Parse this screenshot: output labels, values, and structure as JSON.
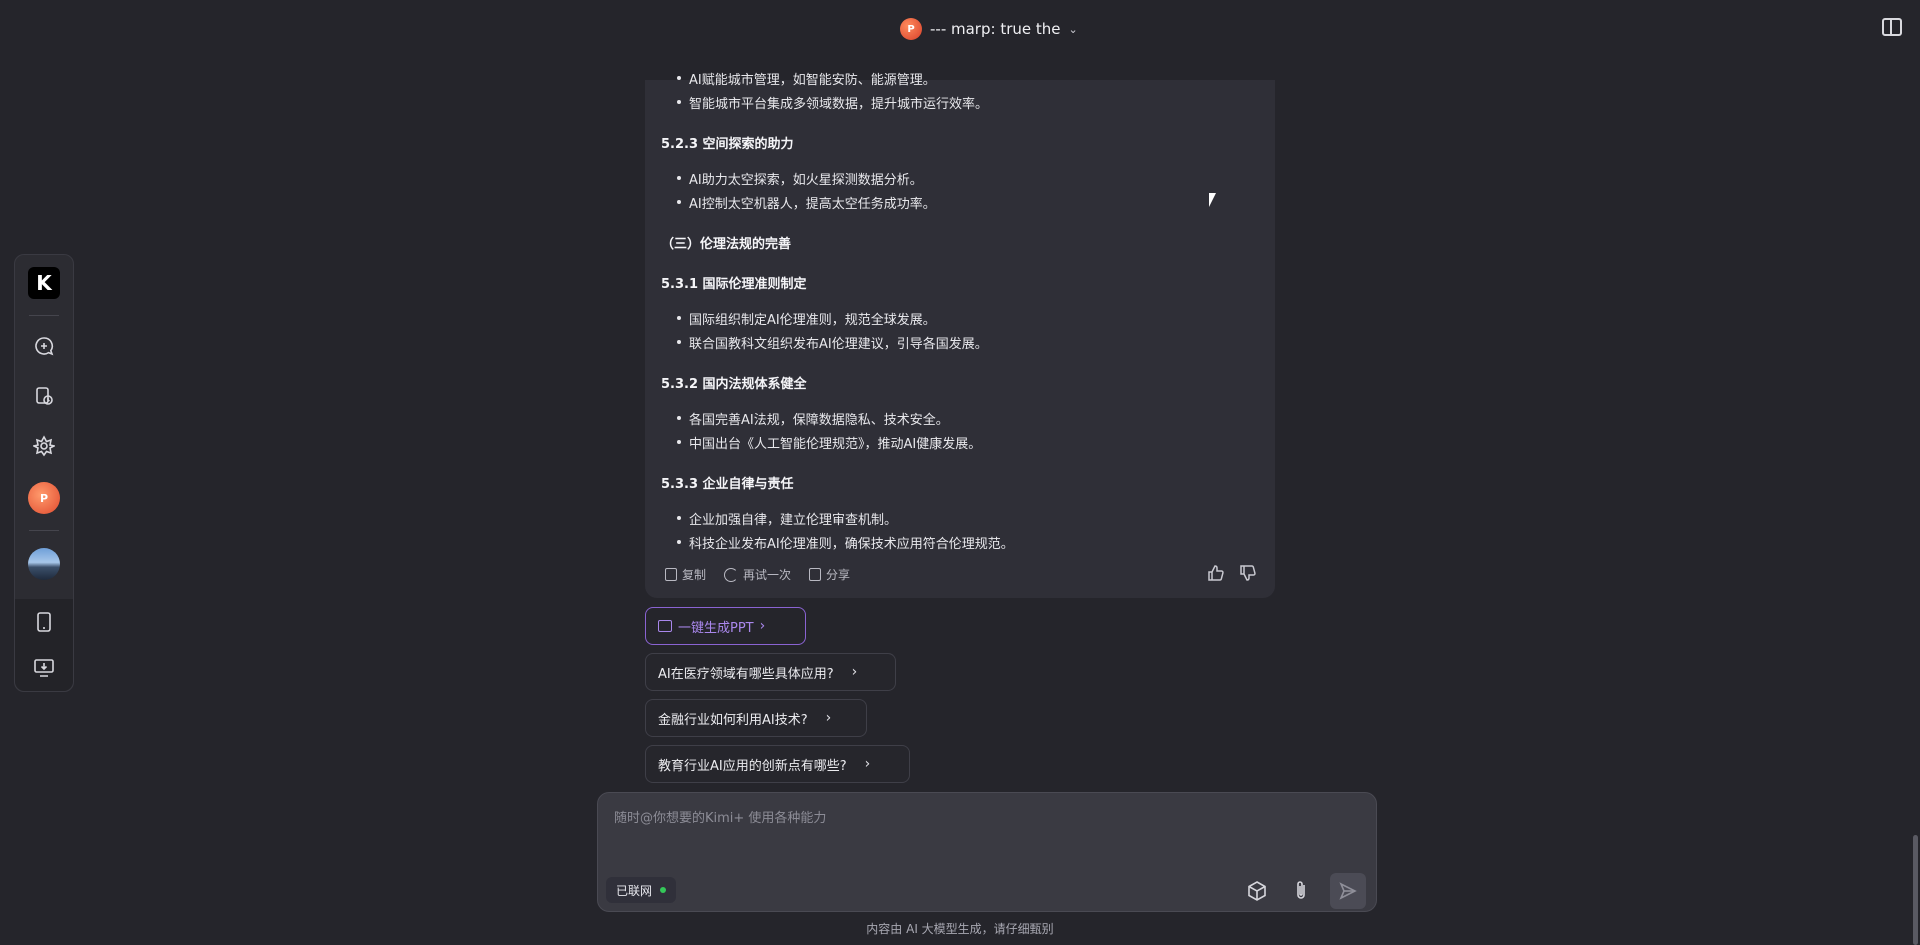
{
  "header": {
    "title": "--- marp: true the",
    "ppt_badge": "P"
  },
  "sidebar": {
    "logo": "K",
    "items": [
      {
        "name": "new-chat-icon"
      },
      {
        "name": "history-icon"
      },
      {
        "name": "kimi-plus-icon"
      },
      {
        "name": "ppt-avatar",
        "label": "P"
      },
      {
        "name": "user-avatar"
      }
    ],
    "bottom": [
      {
        "name": "mobile-icon"
      },
      {
        "name": "desktop-download-icon"
      }
    ]
  },
  "message": {
    "lines": [
      {
        "text": "AI赋能城市管理，如智能安防、能源管理。",
        "type": "bullet"
      },
      {
        "text": "智能城市平台集成多领域数据，提升城市运行效率。",
        "type": "bullet"
      },
      {
        "text": "5.2.3 空间探索的助力",
        "type": "heading"
      },
      {
        "text": "AI助力太空探索，如火星探测数据分析。",
        "type": "bullet"
      },
      {
        "text": "AI控制太空机器人，提高太空任务成功率。",
        "type": "bullet"
      },
      {
        "text": "（三）伦理法规的完善",
        "type": "heading"
      },
      {
        "text": "5.3.1 国际伦理准则制定",
        "type": "heading"
      },
      {
        "text": "国际组织制定AI伦理准则，规范全球发展。",
        "type": "bullet"
      },
      {
        "text": "联合国教科文组织发布AI伦理建议，引导各国发展。",
        "type": "bullet"
      },
      {
        "text": "5.3.2 国内法规体系健全",
        "type": "heading"
      },
      {
        "text": "各国完善AI法规，保障数据隐私、技术安全。",
        "type": "bullet"
      },
      {
        "text": "中国出台《人工智能伦理规范》，推动AI健康发展。",
        "type": "bullet"
      },
      {
        "text": "5.3.3 企业自律与责任",
        "type": "heading"
      },
      {
        "text": "企业加强自律，建立伦理审查机制。",
        "type": "bullet"
      },
      {
        "text": "科技企业发布AI伦理准则，确保技术应用符合伦理规范。",
        "type": "bullet"
      }
    ],
    "actions": {
      "copy": "复制",
      "retry": "再试一次",
      "share": "分享"
    }
  },
  "suggestions": {
    "ppt_button": "一键生成PPT",
    "items": [
      "AI在医疗领域有哪些具体应用?",
      "金融行业如何利用AI技术?",
      "教育行业AI应用的创新点有哪些?"
    ]
  },
  "input": {
    "placeholder": "随时@你想要的Kimi+ 使用各种能力",
    "network_badge": "已联网"
  },
  "footer": {
    "note": "内容由 AI 大模型生成，请仔细甄别"
  },
  "colors": {
    "accent": "#8a63d2",
    "online": "#34c759",
    "background": "#25252b"
  }
}
